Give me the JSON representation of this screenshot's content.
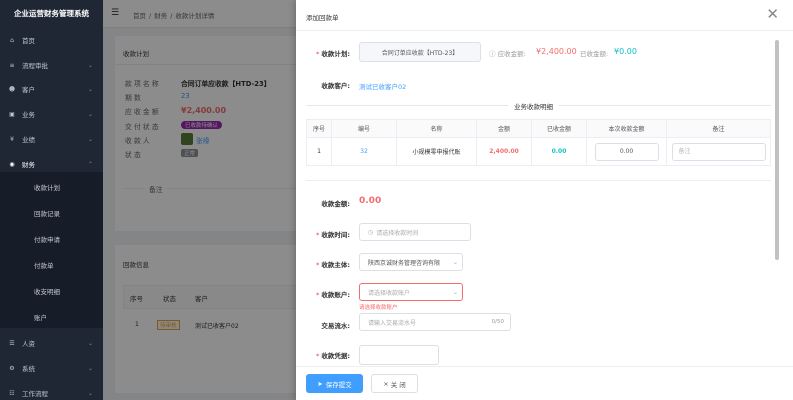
{
  "app": {
    "title": "企业运营财务管理系统"
  },
  "nav": [
    {
      "icon": "⌂",
      "label": "首页"
    },
    {
      "icon": "≡",
      "label": "流程审批"
    },
    {
      "icon": "☻",
      "label": "客户"
    },
    {
      "icon": "▣",
      "label": "业务"
    },
    {
      "icon": "¥",
      "label": "业绩"
    },
    {
      "icon": "◉",
      "label": "财务"
    }
  ],
  "nav_sub": [
    "收款计划",
    "回款记录",
    "付款申请",
    "付款单",
    "收支明细",
    "账户"
  ],
  "nav_bottom": [
    {
      "icon": "☰",
      "label": "人资"
    },
    {
      "icon": "⚙",
      "label": "系统"
    },
    {
      "icon": "☷",
      "label": "工作流程"
    }
  ],
  "breadcrumb": [
    "首页",
    "/",
    "财务",
    "/",
    "收款计划详情"
  ],
  "bg": {
    "section1": "收款计划",
    "kv_labels": [
      "款 项 名 称",
      "期       数",
      "应 收 金 额",
      "交 付 状 态",
      "收    款    人",
      "状       态"
    ],
    "kv_values": [
      "合同订单应收款【HTD-23】",
      "23",
      "¥2,400.00",
      "已收款待确认",
      "张缘",
      ""
    ],
    "status_tag": "正常",
    "remark_label": "备注",
    "section2": "回款信息",
    "table_headers": [
      "序号",
      "状态",
      "客户"
    ],
    "table_row": [
      "1",
      "待审核",
      "测试已收客户02"
    ]
  },
  "drawer": {
    "title": "添加回款单",
    "plan_label": "收款计划:",
    "plan_value": "合同订单应收款【HTD-23】",
    "total_label": "应收金额:",
    "total_value": "¥2,400.00",
    "received_label": "已收金额:",
    "received_value": "¥0.00",
    "customer_label": "收款客户:",
    "customer_value": "测试已收客户02",
    "detail_title": "业务收款明细",
    "table": {
      "headers": [
        "序号",
        "编号",
        "名称",
        "金额",
        "已收金额",
        "本次收款金额",
        "备注"
      ],
      "row": {
        "idx": "1",
        "code": "32",
        "name": "小规模零申报代账",
        "amount": "2,400.00",
        "received": "0.00",
        "this_amount": "0.00",
        "remark_placeholder": "备注"
      }
    },
    "amount_label": "收款金额:",
    "amount_value": "0.00",
    "time_label": "收款时间:",
    "time_placeholder": "请选择收款时间",
    "subject_label": "收款主体:",
    "subject_value": "陕西京诚财务管理咨询有限",
    "account_label": "收款账户:",
    "account_placeholder": "请选择收款账户",
    "account_error": "请选择收款账户",
    "serial_label": "交易流水:",
    "serial_placeholder": "请输入交易流水号",
    "serial_count": "0/50",
    "voucher_label": "收款凭据:",
    "save_label": "保存提交",
    "close_label": "关 闭"
  },
  "colors": {
    "accent": "#409eff",
    "danger": "#f56c6c",
    "success": "#67c23a",
    "teal": "#13c2c2",
    "sidebar": "#1f2735"
  }
}
